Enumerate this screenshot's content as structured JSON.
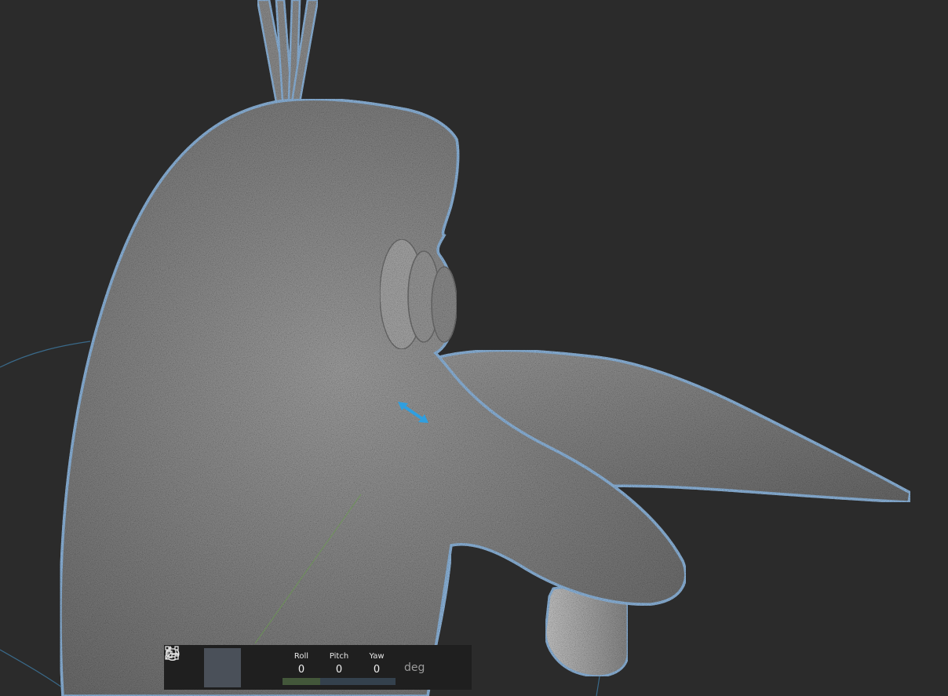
{
  "toolbar": {
    "buttons": [
      {
        "icon": "move-icon",
        "active": false
      },
      {
        "icon": "rotate-icon",
        "active": true
      },
      {
        "icon": "scale-icon",
        "active": false
      },
      {
        "icon": "axis-icon",
        "active": false
      }
    ],
    "rotation": {
      "roll_label": "Roll",
      "roll_value": "0",
      "pitch_label": "Pitch",
      "pitch_value": "0",
      "yaw_label": "Yaw",
      "yaw_value": "0",
      "unit": "deg"
    }
  },
  "colors": {
    "background": "#2b2b2b",
    "mesh_fill": "#8a8a8a",
    "selection_outline": "#8fb8e0",
    "gizmo_arrow": "#2f9fe0",
    "toolbar_bg": "#1f1f1f",
    "active_button": "#4a5059",
    "roll_accent": "#43573a",
    "pitch_yaw_accent": "#34414d"
  }
}
